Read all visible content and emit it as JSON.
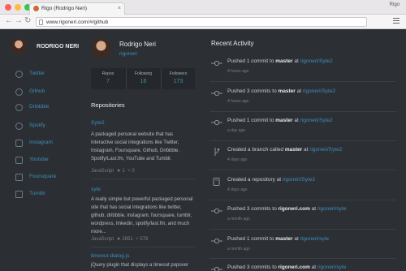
{
  "browser": {
    "tab_title": "Rigo (Rodrigo Neri)",
    "url": "www.rigoneri.com/#/github",
    "user": "Rigo"
  },
  "sidebar": {
    "name": "RODRIGO NERI",
    "items": [
      {
        "label": "Twitter",
        "icon": "twitter-icon"
      },
      {
        "label": "Github",
        "icon": "github-icon"
      },
      {
        "label": "Dribbble",
        "icon": "dribbble-icon"
      },
      {
        "label": "Spotify",
        "icon": "spotify-icon"
      },
      {
        "label": "Instagram",
        "icon": "instagram-icon"
      },
      {
        "label": "Youtube",
        "icon": "youtube-icon"
      },
      {
        "label": "Foursquare",
        "icon": "foursquare-icon"
      },
      {
        "label": "Tumblr",
        "icon": "tumblr-icon"
      }
    ]
  },
  "profile": {
    "name": "Rodrigo Neri",
    "handle": "rigoneri",
    "stats": [
      {
        "label": "Repos",
        "value": "7"
      },
      {
        "label": "Following",
        "value": "16"
      },
      {
        "label": "Followers",
        "value": "173"
      }
    ]
  },
  "repositories": {
    "title": "Repositories",
    "items": [
      {
        "name": "Syte2",
        "description": "A packaged personal website that has interactive social integrations like Twitter, Instagram, Foursquare, Github, Dribbble, Spotify/Last.fm, YouTube and Tumblr.",
        "language": "JavaScript",
        "stars": "1",
        "forks": "0"
      },
      {
        "name": "syte",
        "description": "A really simple but powerful packaged personal site that has social integrations like twitter, github, dribbble, instagram, foursquare, tumblr, wordpress, linkedin, spotify/last.fm, and much more...",
        "language": "JavaScript",
        "stars": "2851",
        "forks": "578"
      },
      {
        "name": "timeout-dialog.js",
        "description": "jQuery plugin that displays a timeout popover after",
        "language": "",
        "stars": "",
        "forks": ""
      }
    ]
  },
  "activity": {
    "title": "Recent Activity",
    "items": [
      {
        "type": "commit",
        "pre": "Pushed 1 commit to ",
        "ref": "master",
        "mid": " at ",
        "repo": "rigoneri/Syte2",
        "time": "4 hours ago"
      },
      {
        "type": "commit",
        "pre": "Pushed 3 commits to ",
        "ref": "master",
        "mid": " at ",
        "repo": "rigoneri/Syte2",
        "time": "4 hours ago"
      },
      {
        "type": "commit",
        "pre": "Pushed 1 commit to ",
        "ref": "master",
        "mid": " at ",
        "repo": "rigoneri/Syte2",
        "time": "a day ago"
      },
      {
        "type": "branch",
        "pre": "Created a branch called ",
        "ref": "master",
        "mid": " at ",
        "repo": "rigoneri/Syte2",
        "time": "4 days ago"
      },
      {
        "type": "repo",
        "pre": "Created a repository at ",
        "ref": "",
        "mid": "",
        "repo": "rigoneri/Syte2",
        "time": "4 days ago"
      },
      {
        "type": "commit",
        "pre": "Pushed 3 commits to ",
        "ref": "rigoneri.com",
        "mid": " at ",
        "repo": "rigoneri/syte",
        "time": "a month ago"
      },
      {
        "type": "commit",
        "pre": "Pushed 1 commit to ",
        "ref": "master",
        "mid": " at ",
        "repo": "rigoneri/syte",
        "time": "a month ago"
      },
      {
        "type": "commit",
        "pre": "Pushed 3 commits to ",
        "ref": "rigoneri.com",
        "mid": " at ",
        "repo": "rigoneri/syte",
        "time": ""
      }
    ]
  },
  "colors": {
    "background": "#2c3035",
    "link": "#3d8eb9",
    "text": "#e8eaec"
  }
}
